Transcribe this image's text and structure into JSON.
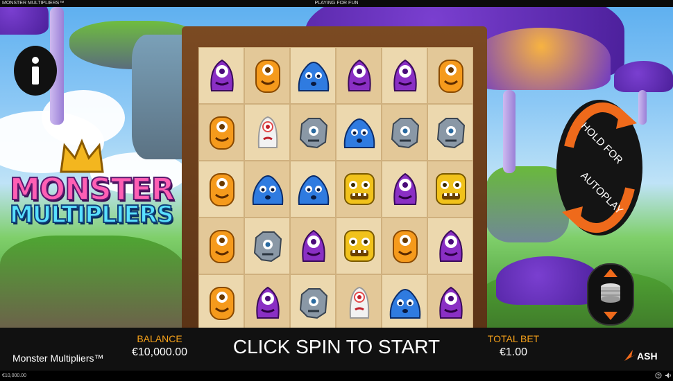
{
  "topbar": {
    "title": "MONSTER MULTIPLIERS™",
    "mode": "PLAYING FOR FUN"
  },
  "logo": {
    "line1": "MONSTER",
    "line2": "MULTIPLIERS",
    "tm": "TM"
  },
  "info_button": {
    "icon": "info-icon"
  },
  "hold_button": {
    "line1": "HOLD FOR",
    "line2": "AUTOPLAY"
  },
  "bet_button": {
    "icon": "coin-stack-icon"
  },
  "reels": [
    [
      "purple-cyclops",
      "orange-cyclops",
      "orange-cyclops",
      "orange-cyclops",
      "orange-cyclops"
    ],
    [
      "orange-cyclops",
      "white-ghost",
      "blue-blob",
      "grey-rock",
      "purple-cyclops"
    ],
    [
      "blue-blob",
      "grey-rock",
      "blue-blob",
      "purple-cyclops",
      "grey-rock"
    ],
    [
      "purple-cyclops",
      "blue-blob",
      "yellow-square",
      "yellow-square",
      "white-ghost"
    ],
    [
      "purple-cyclops",
      "grey-rock",
      "purple-cyclops",
      "orange-cyclops",
      "blue-blob"
    ],
    [
      "orange-cyclops",
      "grey-rock",
      "yellow-square",
      "purple-cyclops",
      "purple-cyclops"
    ]
  ],
  "bottom": {
    "game_name": "Monster Multipliers™",
    "balance_label": "BALANCE",
    "balance_value": "€10,000.00",
    "message": "CLICK SPIN TO START",
    "total_bet_label": "TOTAL BET",
    "total_bet_value": "€1.00",
    "brand": "ASH"
  },
  "statusbar": {
    "balance": "€10,000.00"
  },
  "colors": {
    "accent": "#f6a11a",
    "orange_cyclops": "#f59a1c",
    "purple_cyclops": "#8a2fc4",
    "blue_blob": "#2f7be0",
    "grey_rock": "#8a98a6",
    "yellow_square": "#f1c21b",
    "white_ghost": "#f2f2f2"
  }
}
